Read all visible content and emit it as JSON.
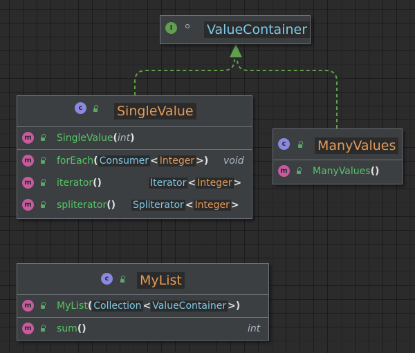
{
  "colors": {
    "background": "#2b2b2b",
    "node": "#3c3f41",
    "border": "#6f737a",
    "class_name": "#e39a5a",
    "interface_name": "#7ec9e8",
    "method_name": "#55c467",
    "arrow": "#5f9f4e"
  },
  "icons": {
    "interface": "I",
    "class": "c",
    "method": "m"
  },
  "value_container": {
    "name": "ValueContainer"
  },
  "single_value": {
    "name": "SingleValue",
    "constructor": {
      "name": "SingleValue",
      "param": "int"
    },
    "methods": [
      {
        "name": "forEach",
        "param_type": "Consumer",
        "param_generic": "Integer",
        "return": "void"
      },
      {
        "name": "iterator",
        "return_type": "Iterator",
        "return_generic": "Integer"
      },
      {
        "name": "spliterator",
        "return_type": "Spliterator",
        "return_generic": "Integer"
      }
    ]
  },
  "many_values": {
    "name": "ManyValues",
    "constructor": {
      "name": "ManyValues"
    }
  },
  "my_list": {
    "name": "MyList",
    "constructor": {
      "name": "MyList",
      "param_type": "Collection",
      "param_generic": "ValueContainer"
    },
    "methods": [
      {
        "name": "sum",
        "return": "int"
      }
    ]
  }
}
